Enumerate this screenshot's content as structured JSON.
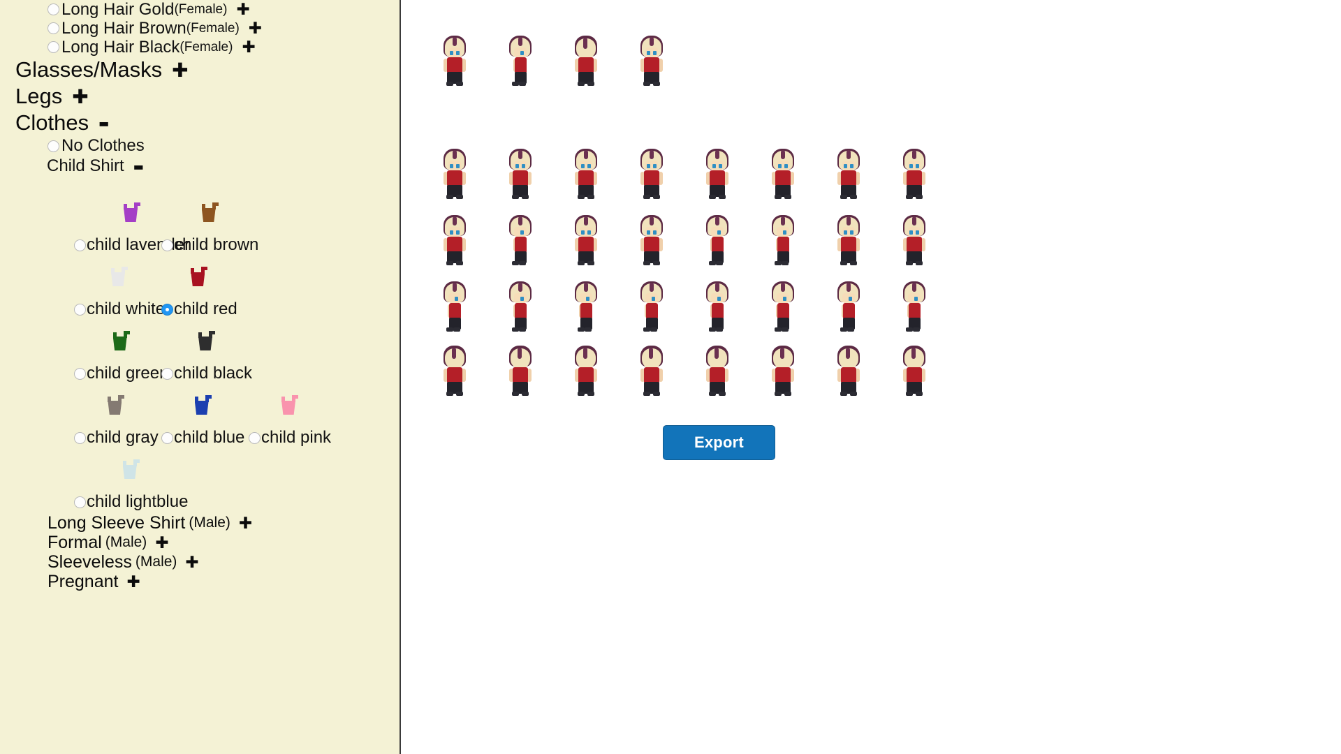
{
  "theme": {
    "sidebar_bg": "#f4f2d5",
    "panel_bg": "#ffffff",
    "sidebar_border": "#3a3a3a",
    "accent_selected": "#2196f3",
    "export_button_bg": "#1274ba",
    "export_button_text": "#ffffff",
    "text_color": "#111111"
  },
  "sidebar": {
    "hair_items": [
      {
        "label": "Long Hair Gold",
        "qualifier": "(Female)",
        "toggle": "+",
        "selected": false
      },
      {
        "label": "Long Hair Brown",
        "qualifier": "(Female)",
        "toggle": "+",
        "selected": false
      },
      {
        "label": "Long Hair Black",
        "qualifier": "(Female)",
        "toggle": "+",
        "selected": false
      }
    ],
    "categories": [
      {
        "label": "Glasses/Masks",
        "toggle": "+",
        "expanded": false
      },
      {
        "label": "Legs",
        "toggle": "+",
        "expanded": false
      },
      {
        "label": "Clothes",
        "toggle": "-",
        "expanded": true
      }
    ],
    "clothes": {
      "no_clothes": {
        "label": "No Clothes",
        "selected": false
      },
      "child_shirt": {
        "label": "Child Shirt",
        "toggle": "-",
        "expanded": true
      },
      "swatch_rows": [
        [
          {
            "label": "child lavender",
            "color": "#a43fc6",
            "selected": false
          },
          {
            "label": "child brown",
            "color": "#8d5520",
            "selected": false
          }
        ],
        [
          {
            "label": "child white",
            "color": "#e8e8e8",
            "selected": false
          },
          {
            "label": "child red",
            "color": "#a81221",
            "selected": true
          }
        ],
        [
          {
            "label": "child green",
            "color": "#1d6a18",
            "selected": false
          },
          {
            "label": "child black",
            "color": "#2e2e2e",
            "selected": false
          }
        ],
        [
          {
            "label": "child gray",
            "color": "#847a72",
            "selected": false
          },
          {
            "label": "child blue",
            "color": "#1b3fb0",
            "selected": false
          },
          {
            "label": "child pink",
            "color": "#f993ad",
            "selected": false
          }
        ],
        [
          {
            "label": "child lightblue",
            "color": "#cfe4e7",
            "selected": false
          }
        ]
      ]
    },
    "bottom_items": [
      {
        "label": "Long Sleeve Shirt",
        "qualifier": "(Male)",
        "toggle": "+"
      },
      {
        "label": "Formal",
        "qualifier": "(Male)",
        "toggle": "+"
      },
      {
        "label": "Sleeveless",
        "qualifier": "(Male)",
        "toggle": "+"
      },
      {
        "label": "Pregnant",
        "qualifier": "",
        "toggle": "+"
      }
    ]
  },
  "preview": {
    "sprite_rows": [
      {
        "count": 4,
        "facing": [
          "front",
          "side",
          "back",
          "front"
        ]
      },
      {
        "count": 8,
        "facing": [
          "front",
          "front",
          "front",
          "front",
          "front",
          "front",
          "front",
          "front"
        ]
      },
      {
        "count": 8,
        "facing": [
          "front",
          "side",
          "front",
          "front",
          "side",
          "side",
          "front",
          "front"
        ]
      },
      {
        "count": 8,
        "facing": [
          "side",
          "side",
          "side",
          "side",
          "side",
          "side",
          "side",
          "side"
        ]
      },
      {
        "count": 8,
        "facing": [
          "back",
          "back",
          "back",
          "back",
          "back",
          "back",
          "back",
          "back"
        ]
      }
    ],
    "character": {
      "hair_color": "#f1e3bd",
      "hair_outline": "#5c2a44",
      "shirt_color": "#b41f28",
      "pants_color": "#23232b",
      "skin_color": "#f6ddb9",
      "eye_color": "#2f8fc4"
    }
  },
  "actions": {
    "export_label": "Export"
  }
}
